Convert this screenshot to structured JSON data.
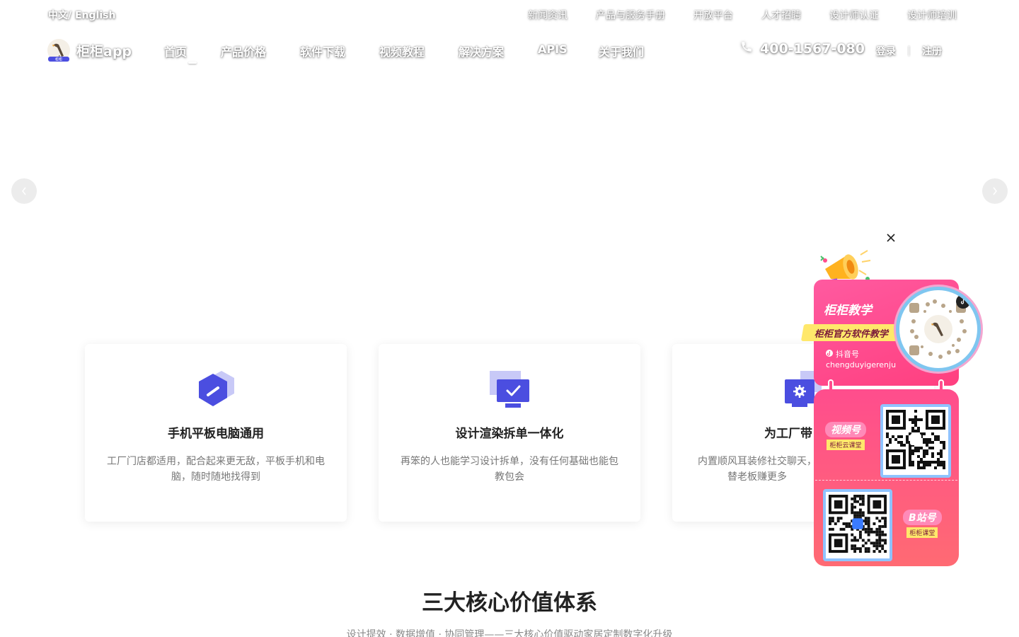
{
  "topbar": {
    "language": "中文/ English",
    "links": [
      "新闻资讯",
      "产品与服务手册",
      "开放平台",
      "人才招聘",
      "设计师认证",
      "设计师培训"
    ]
  },
  "nav": {
    "brand": "柜柜app",
    "logo_badge": "柜柜",
    "items": [
      "首页",
      "产品价格",
      "软件下载",
      "视频教程",
      "解决方案",
      "APIS",
      "关于我们"
    ],
    "active_index": 0,
    "phone": "400-1567-080",
    "login": "登录",
    "register": "注册"
  },
  "carousel": {
    "prev_icon": "chevron-left-icon",
    "next_icon": "chevron-right-icon"
  },
  "features": [
    {
      "icon": "hexagon-slash-icon",
      "title": "手机平板电脑通用",
      "desc": "工厂门店都适用，配合起来更无敌，平板手机和电脑，随时随地找得到"
    },
    {
      "icon": "monitor-check-icon",
      "title": "设计渲染拆单一体化",
      "desc": "再笨的人也能学习设计拆单，没有任何基础也能包教包会"
    },
    {
      "icon": "monitor-gear-icon",
      "title": "为工厂带",
      "desc": "内置顺风耳装修社交聊天，替老板赚更多"
    }
  ],
  "section": {
    "title": "三大核心价值体系",
    "subtitle": "设计提效 · 数据增值 · 协同管理——三大核心价值驱动家居定制数字化升级"
  },
  "promo": {
    "title": "柜柜教学",
    "banner": "柜柜官方软件教学",
    "douyin_label": "抖音号",
    "douyin_id": "chengduyigerenju",
    "video_tag": "视频号",
    "video_sub": "柜柜云课堂",
    "bili_tag": "B站号",
    "bili_sub": "柜柜课堂",
    "close_icon": "close-icon"
  },
  "colors": {
    "accent": "#4b4ee0",
    "accent_light": "#c8c9f7",
    "promo_pink": "#ff4d8d",
    "promo_yellow": "#ffe86b"
  }
}
